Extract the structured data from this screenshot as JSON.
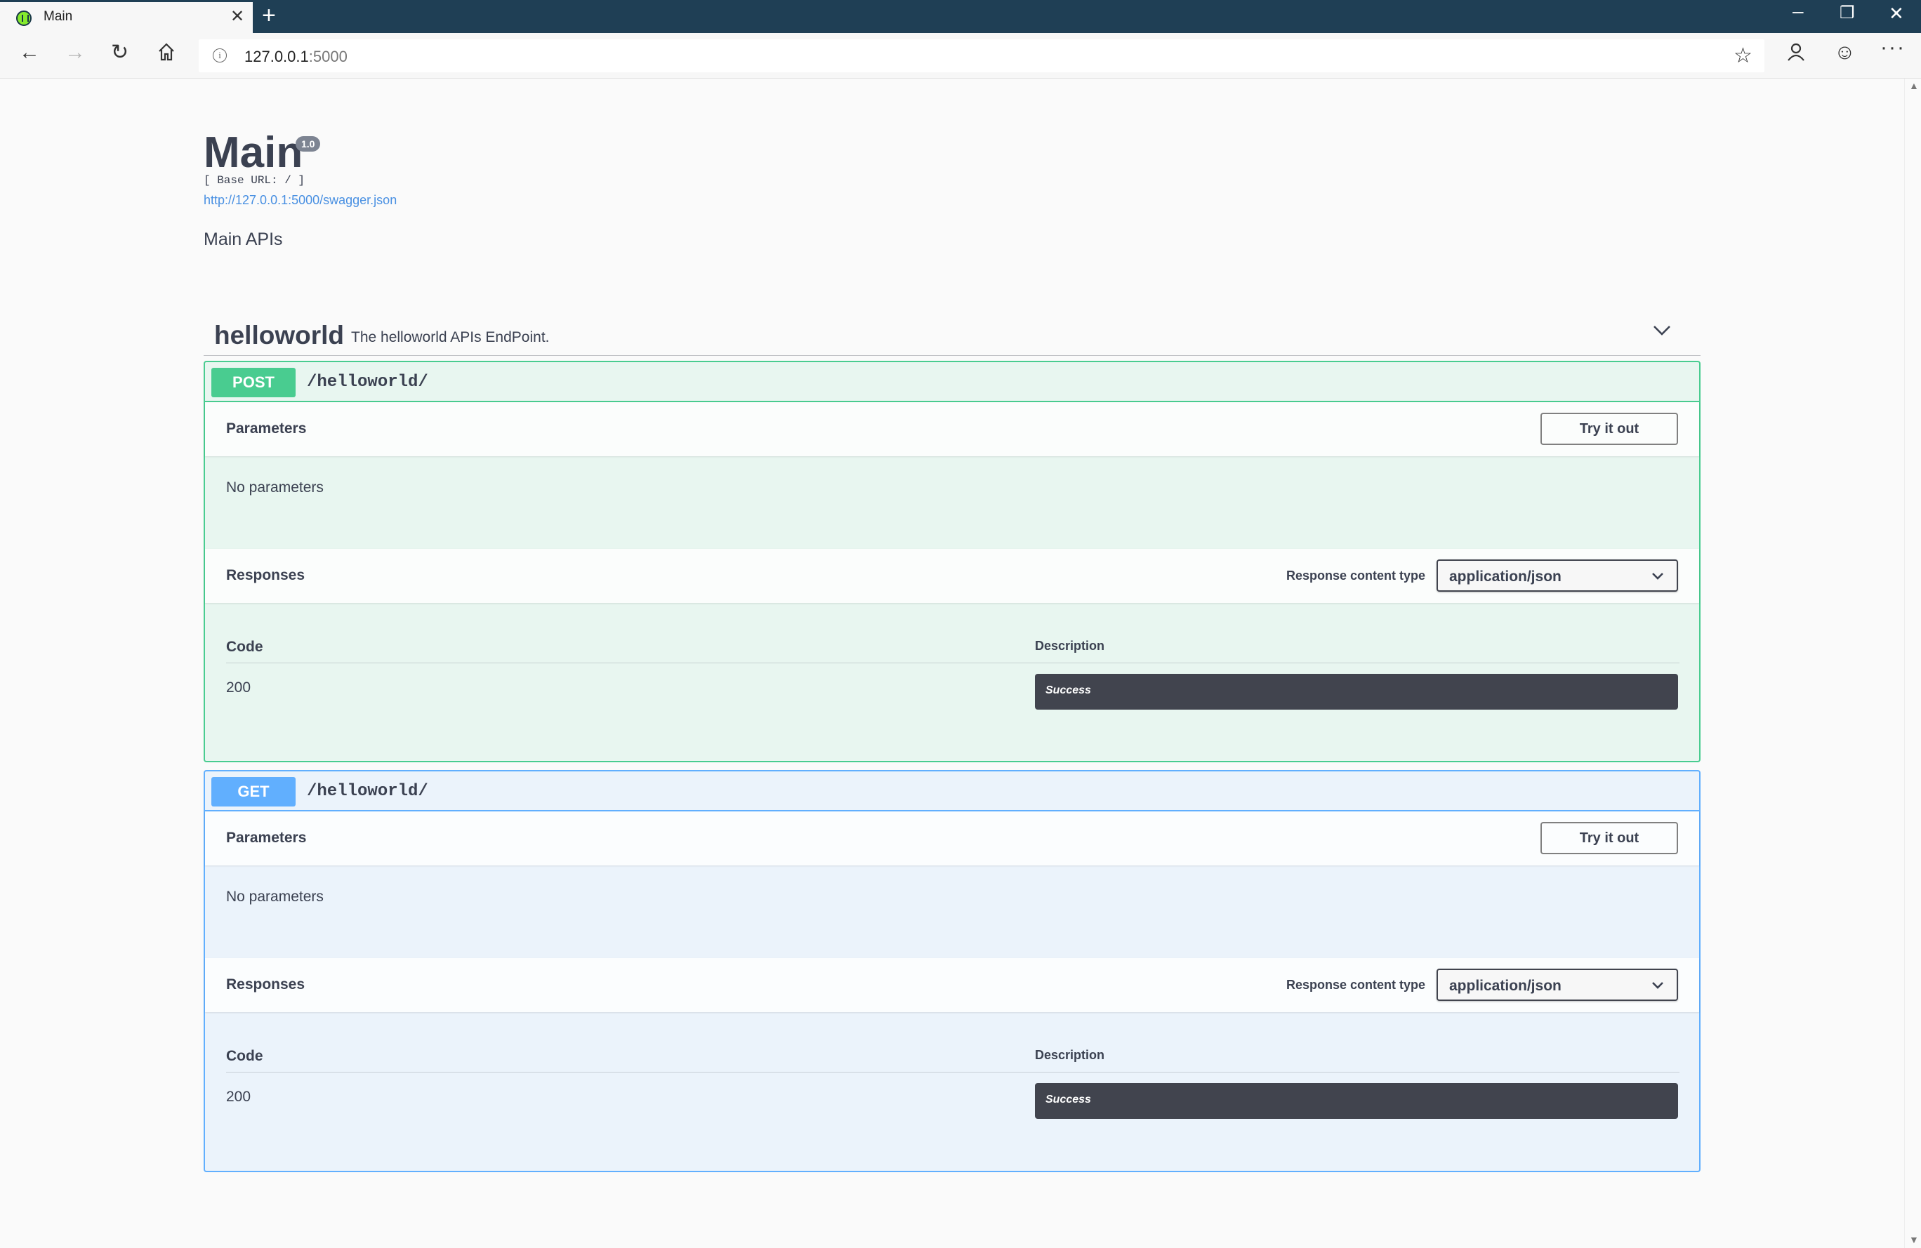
{
  "browser": {
    "tab_title": "Main",
    "address_host": "127.0.0.1",
    "address_port": ":5000"
  },
  "info": {
    "title": "Main",
    "version": "1.0",
    "base_url": "[ Base URL: / ]",
    "spec_link": "http://127.0.0.1:5000/swagger.json",
    "description": "Main APIs"
  },
  "tag": {
    "name": "helloworld",
    "description": "The helloworld APIs EndPoint."
  },
  "operations": [
    {
      "method": "POST",
      "path": "/helloworld/",
      "parameters_title": "Parameters",
      "try_label": "Try it out",
      "no_params": "No parameters",
      "responses_title": "Responses",
      "content_type_label": "Response content type",
      "content_type_value": "application/json",
      "code_header": "Code",
      "description_header": "Description",
      "responses": [
        {
          "code": "200",
          "description": "Success"
        }
      ]
    },
    {
      "method": "GET",
      "path": "/helloworld/",
      "parameters_title": "Parameters",
      "try_label": "Try it out",
      "no_params": "No parameters",
      "responses_title": "Responses",
      "content_type_label": "Response content type",
      "content_type_value": "application/json",
      "code_header": "Code",
      "description_header": "Description",
      "responses": [
        {
          "code": "200",
          "description": "Success"
        }
      ]
    }
  ],
  "colors": {
    "post": "#49cc90",
    "get": "#61affe",
    "dark": "#3b4151"
  }
}
